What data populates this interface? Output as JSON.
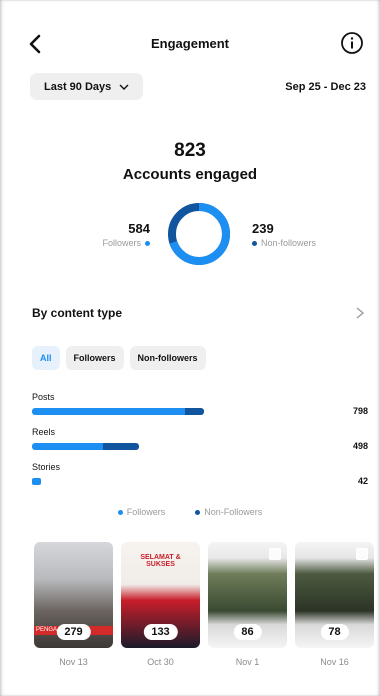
{
  "header": {
    "title": "Engagement"
  },
  "range": {
    "label": "Last 90 Days",
    "dates": "Sep 25 - Dec 23"
  },
  "summary": {
    "total": "823",
    "total_label": "Accounts engaged",
    "followers": {
      "value": "584",
      "label": "Followers",
      "color": "#1d8ff2"
    },
    "non_followers": {
      "value": "239",
      "label": "Non-followers",
      "color": "#11559e"
    },
    "followers_fraction": 0.71
  },
  "content_type": {
    "title": "By content type",
    "chips": [
      "All",
      "Followers",
      "Non-followers"
    ],
    "bars": [
      {
        "label": "Posts",
        "value": "798",
        "followers_fraction": 0.89
      },
      {
        "label": "Reels",
        "value": "498",
        "followers_fraction": 0.66
      },
      {
        "label": "Stories",
        "value": "42",
        "followers_fraction": 1.0
      }
    ],
    "legend": {
      "followers": "Followers",
      "non_followers": "Non-Followers"
    }
  },
  "posts": [
    {
      "count": "279",
      "date": "Nov 13",
      "text": "PENGA   HAN L"
    },
    {
      "count": "133",
      "date": "Oct 30",
      "text": "SELAMAT & SUKSES"
    },
    {
      "count": "86",
      "date": "Nov 1"
    },
    {
      "count": "78",
      "date": "Nov 16"
    }
  ]
}
